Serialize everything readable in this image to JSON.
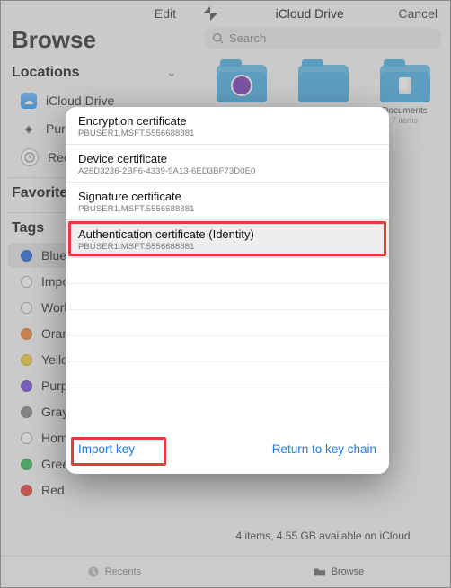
{
  "sidebar": {
    "edit_label": "Edit",
    "title": "Browse",
    "locations_header": "Locations",
    "favorites_header": "Favorites",
    "tags_header": "Tags",
    "locations": [
      {
        "label": "iCloud Drive",
        "icon": "cloud"
      },
      {
        "label": "Purebred...",
        "icon": "purebred"
      },
      {
        "label": "Recent...",
        "icon": "clock"
      }
    ],
    "tags": [
      {
        "label": "Blue",
        "color": "#2f6fe0",
        "hollow": false,
        "active": true
      },
      {
        "label": "Importa...",
        "color": "",
        "hollow": true,
        "active": false
      },
      {
        "label": "Work",
        "color": "",
        "hollow": true,
        "active": false
      },
      {
        "label": "Orange",
        "color": "#f08b3a",
        "hollow": false,
        "active": false
      },
      {
        "label": "Yellow",
        "color": "#f2cf46",
        "hollow": false,
        "active": false
      },
      {
        "label": "Purple",
        "color": "#7a52d6",
        "hollow": false,
        "active": false
      },
      {
        "label": "Gray",
        "color": "#8a8a8e",
        "hollow": false,
        "active": false
      },
      {
        "label": "Home",
        "color": "",
        "hollow": true,
        "active": false
      },
      {
        "label": "Green",
        "color": "#3fb85e",
        "hollow": false,
        "active": false
      },
      {
        "label": "Red",
        "color": "#e2463d",
        "hollow": false,
        "active": false
      }
    ]
  },
  "rightpanel": {
    "title": "iCloud Drive",
    "cancel_label": "Cancel",
    "search_placeholder": "Search",
    "folders": [
      {
        "name": "",
        "meta": "",
        "variant": "badge"
      },
      {
        "name": "",
        "meta": "",
        "variant": "plain"
      },
      {
        "name": "Documents",
        "meta": "7 items",
        "variant": "doc"
      }
    ],
    "status": "4 items, 4.55 GB available on iCloud"
  },
  "tabbar": {
    "recents_label": "Recents",
    "browse_label": "Browse"
  },
  "modal": {
    "certs": [
      {
        "title": "Encryption certificate",
        "sub": "PBUSER1.MSFT.5556688881",
        "selected": false
      },
      {
        "title": "Device certificate",
        "sub": "A26D3236-2BF6-4339-9A13-6ED3BF73D0E0",
        "selected": false
      },
      {
        "title": "Signature certificate",
        "sub": "PBUSER1.MSFT.5556688881",
        "selected": false
      },
      {
        "title": "Authentication certificate (Identity)",
        "sub": "PBUSER1.MSFT.5556688881",
        "selected": true
      }
    ],
    "import_label": "Import key",
    "return_label": "Return to key chain"
  }
}
